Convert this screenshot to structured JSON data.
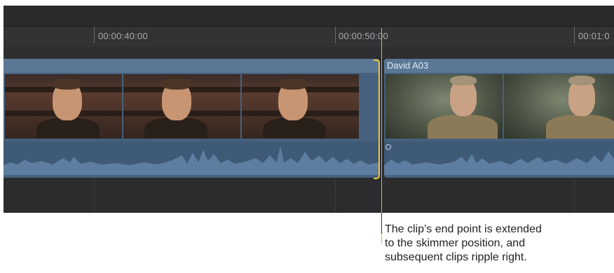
{
  "timeline": {
    "timecodes": [
      "00:00:40:00",
      "00:00:50:00",
      "00:01:0"
    ]
  },
  "clips": {
    "right_clip_name": "David A03"
  },
  "callout": {
    "lines": [
      "The clip’s end point is extended",
      "to the skimmer position, and",
      "subsequent clips ripple right."
    ]
  },
  "colors": {
    "skimmer": "#e8b12f",
    "trim_bracket": "#f0c93c",
    "clip_body": "#45617e",
    "clip_header": "#5a7896",
    "timeline_bg": "#2b2b2d"
  }
}
